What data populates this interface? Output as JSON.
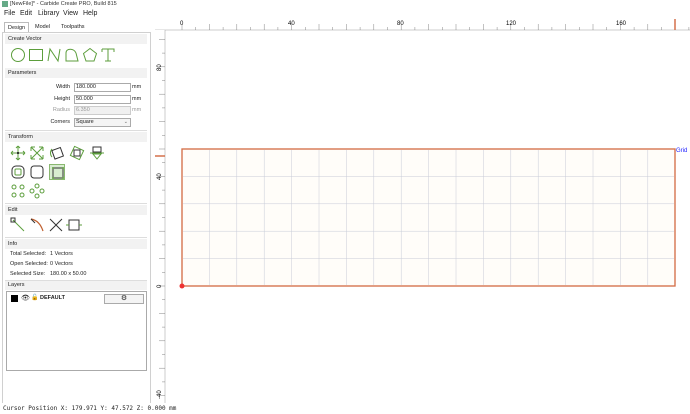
{
  "window": {
    "title": "[NewFile]* - Carbide Create PRO, Build 815"
  },
  "menu": [
    "File",
    "Edit",
    "Library",
    "View",
    "Help"
  ],
  "tabs": [
    "Design",
    "Model",
    "Toolpaths"
  ],
  "create_vector": {
    "heading": "Create Vector",
    "tools": [
      "circle-icon",
      "rectangle-icon",
      "polyline-icon",
      "curve-icon",
      "polygon-icon",
      "text-icon"
    ]
  },
  "parameters": {
    "heading": "Parameters",
    "width": {
      "label": "Width",
      "value": "180.000",
      "unit": "mm"
    },
    "height": {
      "label": "Height",
      "value": "50.000",
      "unit": "mm"
    },
    "radius": {
      "label": "Radius",
      "value": "6.350",
      "unit": "mm"
    },
    "corners": {
      "label": "Corners",
      "value": "Square"
    }
  },
  "transform": {
    "heading": "Transform"
  },
  "edit": {
    "heading": "Edit"
  },
  "info": {
    "heading": "Info",
    "total_selected": {
      "label": "Total Selected:",
      "value": "1 Vectors"
    },
    "open_selected": {
      "label": "Open Selected:",
      "value": "0 Vectors"
    },
    "selected_size": {
      "label": "Selected Size:",
      "value": "180.00 x 50.00"
    }
  },
  "layers": {
    "heading": "Layers",
    "items": [
      {
        "name": "DEFAULT"
      }
    ]
  },
  "canvas": {
    "top_ruler_labels": [
      "0",
      "40",
      "80",
      "120",
      "160"
    ],
    "left_ruler_labels": [
      "80",
      "40",
      "0",
      "-40"
    ],
    "grid_label": "Grid"
  },
  "status": {
    "text": "Cursor Position X: 179.971 Y: 47.572 Z: 0.000 mm"
  },
  "colors": {
    "accent_green": "#5c9e3c",
    "rect_outline": "#d4714a",
    "grid": "#c8ccd8",
    "grid_label": "#1a1aff"
  }
}
